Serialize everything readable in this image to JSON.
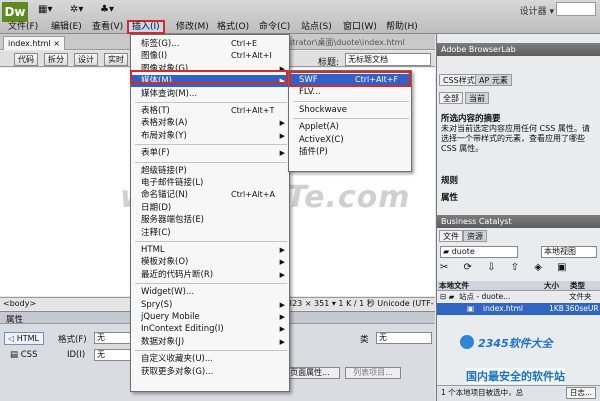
{
  "app": {
    "logo": "Dw",
    "designer": "设计器 ▾"
  },
  "menubar": [
    "文件(F)",
    "编辑(E)",
    "查看(V)",
    "插入(I)",
    "修改(M)",
    "格式(O)",
    "命令(C)",
    "站点(S)",
    "窗口(W)",
    "帮助(H)"
  ],
  "document": {
    "tab": "index.html ×",
    "path": "strator\\桌面\\duote\\index.html",
    "views": [
      "代码",
      "拆分",
      "设计",
      "实时"
    ],
    "title_label": "标题:",
    "title_value": "无标题文档"
  },
  "watermark": "www.DuoTe.com",
  "status": {
    "tag": "<body>",
    "info": "323 × 351 ▾ 1 K / 1 秒 Unicode (UTF-8)"
  },
  "properties": {
    "title": "属性",
    "html": "HTML",
    "css": "CSS",
    "format_label": "格式(F)",
    "format_value": "无",
    "id_label": "ID(I)",
    "id_value": "无",
    "class_label": "类",
    "class_value": "无",
    "page_btn": "页面属性...",
    "list_btn": "列表项目..."
  },
  "insert_menu": [
    {
      "label": "标签(G)...",
      "shortcut": "Ctrl+E"
    },
    {
      "label": "图像(I)",
      "shortcut": "Ctrl+Alt+I"
    },
    {
      "label": "图像对象(G)",
      "arrow": true
    },
    {
      "label": "媒体(M)",
      "arrow": true,
      "highlight": true
    },
    {
      "label": "媒体查询(M)..."
    },
    {
      "sep": true
    },
    {
      "label": "表格(T)",
      "shortcut": "Ctrl+Alt+T"
    },
    {
      "label": "表格对象(A)",
      "arrow": true
    },
    {
      "label": "布局对象(Y)",
      "arrow": true
    },
    {
      "sep": true
    },
    {
      "label": "表单(F)",
      "arrow": true
    },
    {
      "sep": true
    },
    {
      "label": "超级链接(P)"
    },
    {
      "label": "电子邮件链接(L)"
    },
    {
      "label": "命名锚记(N)",
      "shortcut": "Ctrl+Alt+A"
    },
    {
      "label": "日期(D)"
    },
    {
      "label": "服务器端包括(E)"
    },
    {
      "label": "注释(C)"
    },
    {
      "sep": true
    },
    {
      "label": "HTML",
      "arrow": true
    },
    {
      "label": "模板对象(O)",
      "arrow": true
    },
    {
      "label": "最近的代码片断(R)",
      "arrow": true
    },
    {
      "sep": true
    },
    {
      "label": "Widget(W)..."
    },
    {
      "label": "Spry(S)",
      "arrow": true
    },
    {
      "label": "jQuery Mobile",
      "arrow": true
    },
    {
      "label": "InContext Editing(I)",
      "arrow": true
    },
    {
      "label": "数据对象(J)",
      "arrow": true
    },
    {
      "sep": true
    },
    {
      "label": "自定义收藏夹(U)..."
    },
    {
      "label": "获取更多对象(G)..."
    }
  ],
  "media_menu": [
    {
      "label": "SWF",
      "shortcut": "Ctrl+Alt+F",
      "highlight": true
    },
    {
      "label": "FLV..."
    },
    {
      "sep": true
    },
    {
      "label": "Shockwave"
    },
    {
      "sep": true
    },
    {
      "label": "Applet(A)"
    },
    {
      "label": "ActiveX(C)"
    },
    {
      "label": "插件(P)"
    }
  ],
  "panels": {
    "browserlab": "Adobe BrowserLab",
    "css_tabs": [
      "CSS样式",
      "AP 元素"
    ],
    "css_subtabs": [
      "全部",
      "当前"
    ],
    "summary_title": "所选内容的摘要",
    "summary_text": "未对当前选定内容应用任何 CSS 属性。请选择一个带样式的元素，查看应用了哪些 CSS 属性。",
    "rules": "规则",
    "props": "属性",
    "bc": "Business Catalyst",
    "file_tabs": [
      "文件",
      "资源"
    ],
    "site": "duote",
    "view": "本地视图",
    "file_cols": [
      "本地文件",
      "大小",
      "类型"
    ],
    "files": [
      {
        "name": "站点 - duote...",
        "size": "",
        "type": "文件夹"
      },
      {
        "name": "index.html",
        "size": "1KB",
        "type": "360seUR"
      }
    ],
    "footer": "1 个本地项目被选中，总",
    "log": "日志..."
  },
  "brand": {
    "text": "2345软件大全",
    "slogan": "国内最安全的软件站",
    "colors": {
      "accent": "#1a73c8"
    }
  }
}
